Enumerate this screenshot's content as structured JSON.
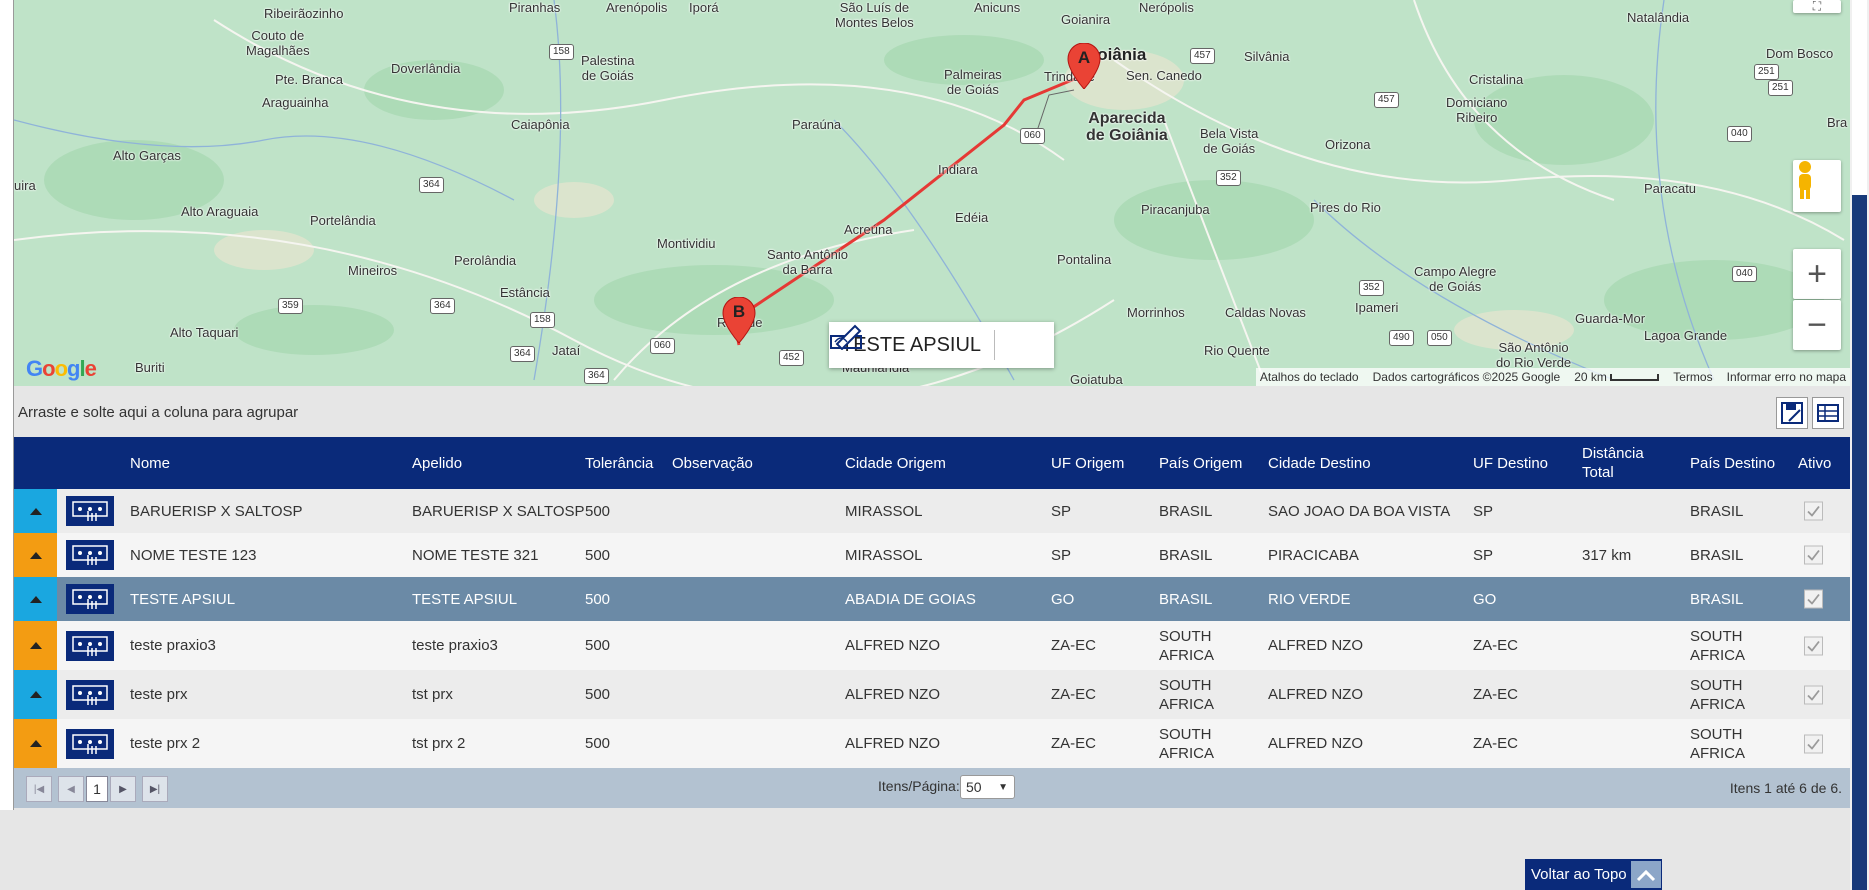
{
  "map": {
    "places": [
      {
        "text": "Ribeirãozinho",
        "cls": ""
      },
      {
        "text": "Couto de\nMagalhães",
        "cls": ""
      },
      {
        "text": "Pte. Branca",
        "cls": ""
      },
      {
        "text": "Doverlândia",
        "cls": ""
      },
      {
        "text": "Palestina\nde Goiás",
        "cls": ""
      },
      {
        "text": "Araguainha",
        "cls": ""
      },
      {
        "text": "Caiapônia",
        "cls": ""
      },
      {
        "text": "Alto Garças",
        "cls": ""
      },
      {
        "text": "Alto Araguaia",
        "cls": ""
      },
      {
        "text": "Portelândia",
        "cls": ""
      },
      {
        "text": "Perolândia",
        "cls": ""
      },
      {
        "text": "Mineiros",
        "cls": ""
      },
      {
        "text": "Estância",
        "cls": ""
      },
      {
        "text": "Alto Taquari",
        "cls": ""
      },
      {
        "text": "Jataí",
        "cls": ""
      },
      {
        "text": "Buriti",
        "cls": ""
      },
      {
        "text": "Montividiu",
        "cls": ""
      },
      {
        "text": "Santo Antônio\nda Barra",
        "cls": ""
      },
      {
        "text": "Acreúna",
        "cls": ""
      },
      {
        "text": "Paraúna",
        "cls": ""
      },
      {
        "text": "Indiara",
        "cls": ""
      },
      {
        "text": "Edéia",
        "cls": ""
      },
      {
        "text": "Palmeiras\nde Goiás",
        "cls": ""
      },
      {
        "text": "Trindade",
        "cls": ""
      },
      {
        "text": "Goiânia",
        "cls": "big"
      },
      {
        "text": "Aparecida\nde Goiânia",
        "cls": "mid"
      },
      {
        "text": "Sen. Canedo",
        "cls": ""
      },
      {
        "text": "Silvânia",
        "cls": ""
      },
      {
        "text": "Bela Vista\nde Goiás",
        "cls": ""
      },
      {
        "text": "Orizona",
        "cls": ""
      },
      {
        "text": "Piracanjuba",
        "cls": ""
      },
      {
        "text": "Pires do Rio",
        "cls": ""
      },
      {
        "text": "Pontalina",
        "cls": ""
      },
      {
        "text": "Morrinhos",
        "cls": ""
      },
      {
        "text": "Caldas Novas",
        "cls": ""
      },
      {
        "text": "Ipameri",
        "cls": ""
      },
      {
        "text": "Rio Quente",
        "cls": ""
      },
      {
        "text": "Campo Alegre\nde Goiás",
        "cls": ""
      },
      {
        "text": "Cristalina",
        "cls": ""
      },
      {
        "text": "Domiciano\nRibeiro",
        "cls": ""
      },
      {
        "text": "Paracatu",
        "cls": ""
      },
      {
        "text": "Guarda-Mor",
        "cls": ""
      },
      {
        "text": "Lagoa Grande",
        "cls": ""
      },
      {
        "text": "São Antônio\ndo Rio Verde",
        "cls": ""
      },
      {
        "text": "Natalândia",
        "cls": ""
      },
      {
        "text": "Dom Bosco",
        "cls": ""
      },
      {
        "text": "Goianira",
        "cls": ""
      },
      {
        "text": "Nerópolis",
        "cls": ""
      },
      {
        "text": "Anicuns",
        "cls": ""
      },
      {
        "text": "São Luís de\nMontes Belos",
        "cls": ""
      },
      {
        "text": "Iporá",
        "cls": ""
      },
      {
        "text": "Arenópolis",
        "cls": ""
      },
      {
        "text": "Piranhas",
        "cls": ""
      },
      {
        "text": "Ri  erde",
        "cls": ""
      },
      {
        "text": "Goiatuba",
        "cls": ""
      },
      {
        "text": "Maurilândia",
        "cls": ""
      },
      {
        "text": "uira",
        "cls": ""
      },
      {
        "text": "Bra",
        "cls": ""
      }
    ],
    "shields": [
      "158",
      "364",
      "359",
      "364",
      "158",
      "364",
      "060",
      "452",
      "364",
      "060",
      "457",
      "457",
      "352",
      "352",
      "490",
      "050",
      "040",
      "040",
      "251",
      "251"
    ],
    "marker_a": "A",
    "marker_b": "B",
    "google_logo": "Google",
    "footer": {
      "keyboard": "Atalhos do teclado",
      "copyright": "Dados cartográficos ©2025 Google",
      "scale": "20 km",
      "terms": "Termos",
      "report": "Informar erro no mapa"
    },
    "infobox_title": "TESTE APSIUL"
  },
  "groupbar_hint": "Arraste e solte aqui a coluna para agrupar",
  "columns": {
    "nome": "Nome",
    "apelido": "Apelido",
    "tolerancia": "Tolerância",
    "observacao": "Observação",
    "cidade_origem": "Cidade Origem",
    "uf_origem": "UF Origem",
    "pais_origem": "País Origem",
    "cidade_destino": "Cidade Destino",
    "uf_destino": "UF Destino",
    "distancia": "Distância\nTotal",
    "pais_destino": "País Destino",
    "ativo": "Ativo"
  },
  "rows": [
    {
      "nome": "BARUERISP X SALTOSP",
      "apelido": "BARUERISP X SALTOSP",
      "tolerancia": "500",
      "observacao": "",
      "cidade_origem": "MIRASSOL",
      "uf_origem": "SP",
      "pais_origem": "BRASIL",
      "cidade_destino": "SAO JOAO DA BOA VISTA",
      "uf_destino": "SP",
      "distancia": "",
      "pais_destino": "BRASIL",
      "ativo": true
    },
    {
      "nome": "NOME TESTE 123",
      "apelido": "NOME TESTE 321",
      "tolerancia": "500",
      "observacao": "",
      "cidade_origem": "MIRASSOL",
      "uf_origem": "SP",
      "pais_origem": "BRASIL",
      "cidade_destino": "PIRACICABA",
      "uf_destino": "SP",
      "distancia": "317 km",
      "pais_destino": "BRASIL",
      "ativo": true
    },
    {
      "nome": "TESTE APSIUL",
      "apelido": "TESTE APSIUL",
      "tolerancia": "500",
      "observacao": "",
      "cidade_origem": "ABADIA DE GOIAS",
      "uf_origem": "GO",
      "pais_origem": "BRASIL",
      "cidade_destino": "RIO VERDE",
      "uf_destino": "GO",
      "distancia": "",
      "pais_destino": "BRASIL",
      "ativo": true
    },
    {
      "nome": "teste praxio3",
      "apelido": "teste praxio3",
      "tolerancia": "500",
      "observacao": "",
      "cidade_origem": "ALFRED NZO",
      "uf_origem": "ZA-EC",
      "pais_origem": "SOUTH\nAFRICA",
      "cidade_destino": "ALFRED NZO",
      "uf_destino": "ZA-EC",
      "distancia": "",
      "pais_destino": "SOUTH\nAFRICA",
      "ativo": true
    },
    {
      "nome": "teste prx",
      "apelido": "tst prx",
      "tolerancia": "500",
      "observacao": "",
      "cidade_origem": "ALFRED NZO",
      "uf_origem": "ZA-EC",
      "pais_origem": "SOUTH\nAFRICA",
      "cidade_destino": "ALFRED NZO",
      "uf_destino": "ZA-EC",
      "distancia": "",
      "pais_destino": "SOUTH\nAFRICA",
      "ativo": true
    },
    {
      "nome": "teste prx 2",
      "apelido": "tst prx 2",
      "tolerancia": "500",
      "observacao": "",
      "cidade_origem": "ALFRED NZO",
      "uf_origem": "ZA-EC",
      "pais_origem": "SOUTH\nAFRICA",
      "cidade_destino": "ALFRED NZO",
      "uf_destino": "ZA-EC",
      "distancia": "",
      "pais_destino": "SOUTH\nAFRICA",
      "ativo": true
    }
  ],
  "pager": {
    "page": "1",
    "per_page_label": "Itens/Página:",
    "per_page_value": "50",
    "info": "Itens 1 até 6 de 6."
  },
  "back_to_top": "Voltar ao Topo",
  "colors": {
    "header": "#0a2a7a",
    "selected_row": "#6b8aa6",
    "expander_a": "#1aa7e0",
    "expander_b": "#f39c12",
    "route": "#e53935",
    "marker": "#ea4335"
  }
}
